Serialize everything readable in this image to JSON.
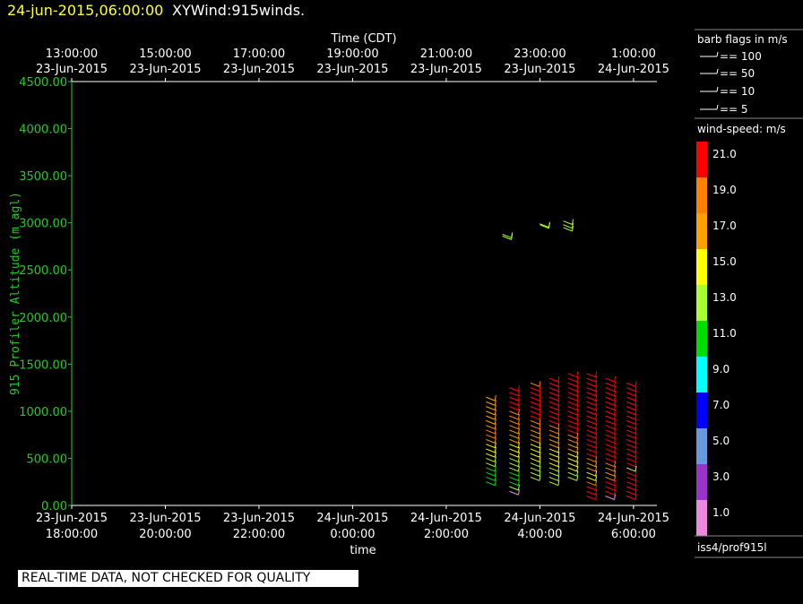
{
  "header": {
    "datetime": "24-jun-2015,06:00:00",
    "product": "XYWind:915winds."
  },
  "colors": {
    "background": "#000000",
    "axis": "#ffffff",
    "y_axis": "#22cc22",
    "title_date": "#ffff33"
  },
  "chart_data": {
    "type": "scatter",
    "title": "",
    "ylabel": "915 Profiler Altitude (m agl)",
    "ylim": [
      0,
      4500
    ],
    "y_ticks": [
      "4500.00",
      "4000.00",
      "3500.00",
      "3000.00",
      "2500.00",
      "2000.00",
      "1500.00",
      "1000.00",
      "500.00",
      "0.00"
    ],
    "y_tick_values": [
      4500,
      4000,
      3500,
      3000,
      2500,
      2000,
      1500,
      1000,
      500,
      0
    ],
    "x_axis_bottom": {
      "label": "time",
      "range_hours": [
        0,
        12.5
      ],
      "ticks": [
        {
          "h": 0,
          "line1": "23-Jun-2015",
          "line2": "18:00:00"
        },
        {
          "h": 2,
          "line1": "23-Jun-2015",
          "line2": "20:00:00"
        },
        {
          "h": 4,
          "line1": "23-Jun-2015",
          "line2": "22:00:00"
        },
        {
          "h": 6,
          "line1": "24-Jun-2015",
          "line2": "0:00:00"
        },
        {
          "h": 8,
          "line1": "24-Jun-2015",
          "line2": "2:00:00"
        },
        {
          "h": 10,
          "line1": "24-Jun-2015",
          "line2": "4:00:00"
        },
        {
          "h": 12,
          "line1": "24-Jun-2015",
          "line2": "6:00:00"
        }
      ]
    },
    "x_axis_top": {
      "label": "Time (CDT)",
      "ticks": [
        {
          "h": 0,
          "line1": "13:00:00",
          "line2": "23-Jun-2015"
        },
        {
          "h": 2,
          "line1": "15:00:00",
          "line2": "23-Jun-2015"
        },
        {
          "h": 4,
          "line1": "17:00:00",
          "line2": "23-Jun-2015"
        },
        {
          "h": 6,
          "line1": "19:00:00",
          "line2": "23-Jun-2015"
        },
        {
          "h": 8,
          "line1": "21:00:00",
          "line2": "23-Jun-2015"
        },
        {
          "h": 10,
          "line1": "23:00:00",
          "line2": "23-Jun-2015"
        },
        {
          "h": 12,
          "line1": "1:00:00",
          "line2": "24-Jun-2015"
        }
      ]
    },
    "series": [
      {
        "time_h": 8.85,
        "points": [
          [
            1150,
            17
          ],
          [
            1100,
            17
          ],
          [
            1050,
            17
          ],
          [
            1000,
            17
          ],
          [
            950,
            17
          ],
          [
            900,
            17
          ],
          [
            850,
            17
          ],
          [
            800,
            19
          ],
          [
            750,
            19
          ],
          [
            700,
            17
          ],
          [
            650,
            15
          ],
          [
            600,
            15
          ],
          [
            550,
            15
          ],
          [
            500,
            13
          ],
          [
            450,
            13
          ],
          [
            400,
            11
          ],
          [
            350,
            11
          ],
          [
            300,
            11
          ],
          [
            250,
            11
          ]
        ]
      },
      {
        "time_h": 9.35,
        "points": [
          [
            1250,
            21
          ],
          [
            1200,
            21
          ],
          [
            1150,
            21
          ],
          [
            1100,
            21
          ],
          [
            1050,
            21
          ],
          [
            1000,
            19
          ],
          [
            950,
            19
          ],
          [
            900,
            19
          ],
          [
            850,
            19
          ],
          [
            800,
            17
          ],
          [
            750,
            17
          ],
          [
            700,
            17
          ],
          [
            650,
            15
          ],
          [
            600,
            15
          ],
          [
            550,
            15
          ],
          [
            500,
            13
          ],
          [
            450,
            13
          ],
          [
            400,
            13
          ],
          [
            350,
            11
          ],
          [
            300,
            11
          ],
          [
            250,
            11
          ],
          [
            200,
            13
          ],
          [
            150,
            1
          ]
        ]
      },
      {
        "time_h": 9.8,
        "points": [
          [
            1300,
            19
          ],
          [
            1250,
            21
          ],
          [
            1200,
            21
          ],
          [
            1150,
            21
          ],
          [
            1100,
            21
          ],
          [
            1050,
            21
          ],
          [
            1000,
            21
          ],
          [
            950,
            21
          ],
          [
            900,
            19
          ],
          [
            850,
            19
          ],
          [
            800,
            17
          ],
          [
            750,
            17
          ],
          [
            700,
            17
          ],
          [
            650,
            15
          ],
          [
            600,
            15
          ],
          [
            550,
            15
          ],
          [
            500,
            15
          ],
          [
            450,
            13
          ],
          [
            400,
            13
          ],
          [
            350,
            13
          ],
          [
            300,
            13
          ]
        ]
      },
      {
        "time_h": 10.2,
        "points": [
          [
            1350,
            21
          ],
          [
            1300,
            21
          ],
          [
            1250,
            21
          ],
          [
            1200,
            21
          ],
          [
            1150,
            21
          ],
          [
            1100,
            21
          ],
          [
            1050,
            21
          ],
          [
            1000,
            21
          ],
          [
            950,
            21
          ],
          [
            900,
            21
          ],
          [
            850,
            19
          ],
          [
            800,
            19
          ],
          [
            750,
            17
          ],
          [
            700,
            17
          ],
          [
            650,
            17
          ],
          [
            600,
            15
          ],
          [
            550,
            15
          ],
          [
            500,
            15
          ],
          [
            450,
            15
          ],
          [
            400,
            13
          ],
          [
            350,
            13
          ],
          [
            300,
            13
          ],
          [
            250,
            13
          ]
        ]
      },
      {
        "time_h": 10.6,
        "points": [
          [
            1400,
            21
          ],
          [
            1350,
            21
          ],
          [
            1300,
            21
          ],
          [
            1250,
            21
          ],
          [
            1200,
            21
          ],
          [
            1150,
            21
          ],
          [
            1100,
            21
          ],
          [
            1050,
            21
          ],
          [
            1000,
            21
          ],
          [
            950,
            21
          ],
          [
            900,
            21
          ],
          [
            850,
            21
          ],
          [
            800,
            21
          ],
          [
            750,
            19
          ],
          [
            700,
            19
          ],
          [
            650,
            17
          ],
          [
            600,
            17
          ],
          [
            550,
            15
          ],
          [
            500,
            15
          ],
          [
            450,
            15
          ],
          [
            400,
            15
          ],
          [
            350,
            13
          ],
          [
            300,
            13
          ]
        ]
      },
      {
        "time_h": 11.0,
        "points": [
          [
            1400,
            21
          ],
          [
            1350,
            21
          ],
          [
            1300,
            21
          ],
          [
            1250,
            21
          ],
          [
            1200,
            21
          ],
          [
            1150,
            21
          ],
          [
            1100,
            21
          ],
          [
            1050,
            21
          ],
          [
            1000,
            21
          ],
          [
            950,
            21
          ],
          [
            900,
            21
          ],
          [
            850,
            21
          ],
          [
            800,
            21
          ],
          [
            750,
            21
          ],
          [
            700,
            21
          ],
          [
            650,
            21
          ],
          [
            600,
            21
          ],
          [
            550,
            21
          ],
          [
            500,
            19
          ],
          [
            450,
            17
          ],
          [
            400,
            17
          ],
          [
            350,
            15
          ],
          [
            300,
            15
          ],
          [
            250,
            19
          ],
          [
            200,
            21
          ],
          [
            150,
            21
          ],
          [
            100,
            21
          ]
        ]
      },
      {
        "time_h": 11.4,
        "points": [
          [
            1350,
            21
          ],
          [
            1300,
            21
          ],
          [
            1250,
            21
          ],
          [
            1200,
            21
          ],
          [
            1150,
            21
          ],
          [
            1100,
            21
          ],
          [
            1050,
            21
          ],
          [
            1000,
            21
          ],
          [
            950,
            21
          ],
          [
            900,
            21
          ],
          [
            850,
            21
          ],
          [
            800,
            21
          ],
          [
            750,
            21
          ],
          [
            700,
            21
          ],
          [
            650,
            21
          ],
          [
            600,
            21
          ],
          [
            550,
            21
          ],
          [
            500,
            21
          ],
          [
            450,
            19
          ],
          [
            400,
            19
          ],
          [
            350,
            17
          ],
          [
            300,
            19
          ],
          [
            250,
            21
          ],
          [
            200,
            21
          ],
          [
            150,
            21
          ],
          [
            100,
            1
          ]
        ]
      },
      {
        "time_h": 11.85,
        "points": [
          [
            1300,
            21
          ],
          [
            1250,
            21
          ],
          [
            1200,
            21
          ],
          [
            1150,
            21
          ],
          [
            1100,
            21
          ],
          [
            1050,
            21
          ],
          [
            1000,
            21
          ],
          [
            950,
            21
          ],
          [
            900,
            21
          ],
          [
            850,
            21
          ],
          [
            800,
            21
          ],
          [
            750,
            21
          ],
          [
            700,
            21
          ],
          [
            650,
            21
          ],
          [
            600,
            21
          ],
          [
            550,
            21
          ],
          [
            500,
            21
          ],
          [
            450,
            21
          ],
          [
            400,
            21
          ],
          [
            350,
            21
          ],
          [
            300,
            21
          ],
          [
            250,
            21
          ],
          [
            200,
            21
          ],
          [
            150,
            21
          ],
          [
            100,
            21
          ],
          [
            400,
            13
          ]
        ]
      },
      {
        "time_h": 9.2,
        "points": [
          [
            2880,
            13
          ],
          [
            2860,
            13
          ]
        ]
      },
      {
        "time_h": 10.0,
        "points": [
          [
            2990,
            13
          ],
          [
            2980,
            13
          ]
        ]
      },
      {
        "time_h": 10.5,
        "points": [
          [
            3020,
            13
          ],
          [
            2980,
            13
          ],
          [
            2950,
            13
          ]
        ]
      }
    ]
  },
  "legend": {
    "barb_title": "barb flags in m/s",
    "barbs": [
      "== 100",
      "== 50",
      "== 10",
      "== 5"
    ],
    "speed_title": "wind-speed: m/s",
    "speeds": [
      {
        "label": "21.0",
        "color": "#ff0000"
      },
      {
        "label": "19.0",
        "color": "#ff8000"
      },
      {
        "label": "17.0",
        "color": "#ffa000"
      },
      {
        "label": "15.0",
        "color": "#ffff00"
      },
      {
        "label": "13.0",
        "color": "#aaff33"
      },
      {
        "label": "11.0",
        "color": "#00dd00"
      },
      {
        "label": "9.0",
        "color": "#00ffff"
      },
      {
        "label": "7.0",
        "color": "#0000ff"
      },
      {
        "label": "5.0",
        "color": "#6699dd"
      },
      {
        "label": "3.0",
        "color": "#9933cc"
      },
      {
        "label": "1.0",
        "color": "#ee88dd"
      }
    ],
    "platform": "iss4/prof915l"
  },
  "footer": {
    "qc_notice": "REAL-TIME DATA, NOT CHECKED FOR QUALITY"
  }
}
